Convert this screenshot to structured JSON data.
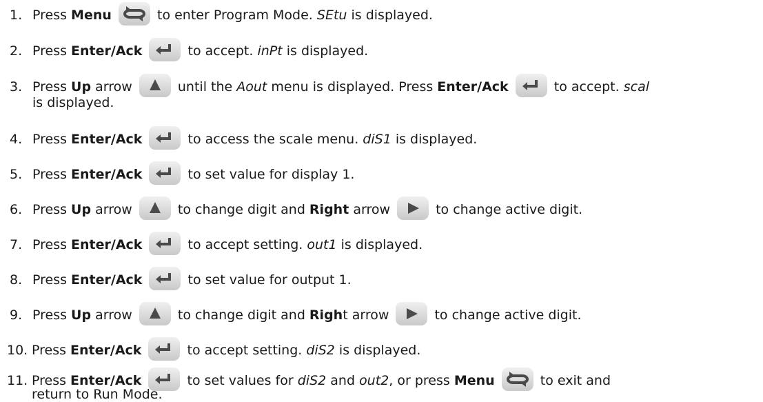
{
  "steps": [
    {
      "num": "1.",
      "parts": [
        "Press ",
        "Menu",
        "to enter Program Mode. ",
        "SEtu",
        " is displayed."
      ]
    },
    {
      "num": "2.",
      "parts": [
        "Press ",
        "Enter/Ack",
        "to accept. ",
        "inPt",
        " is displayed."
      ]
    },
    {
      "num": "3.",
      "parts": [
        "Press ",
        "Up",
        " arrow",
        "until the ",
        "Aout",
        " menu is displayed. Press ",
        "Enter/Ack",
        "to accept. ",
        "scal",
        "is displayed."
      ]
    },
    {
      "num": "4.",
      "parts": [
        "Press ",
        "Enter/Ack",
        "to access the scale menu. ",
        "diS1",
        " is displayed."
      ]
    },
    {
      "num": "5.",
      "parts": [
        "Press ",
        "Enter/Ack",
        "to set value for display 1."
      ]
    },
    {
      "num": "6.",
      "parts": [
        "Press ",
        "Up",
        " arrow",
        "to change digit and ",
        "Right",
        " arrow",
        "to change active digit."
      ]
    },
    {
      "num": "7.",
      "parts": [
        "Press ",
        "Enter/Ack",
        "to accept setting. ",
        "out1",
        " is displayed."
      ]
    },
    {
      "num": "8.",
      "parts": [
        "Press ",
        "Enter/Ack",
        "to set value for output 1."
      ]
    },
    {
      "num": "9.",
      "parts": [
        "Press ",
        "Up",
        " arrow",
        "to change digit and ",
        "Righ",
        "t arrow",
        "to change active digit."
      ]
    },
    {
      "num": "10.",
      "parts": [
        "Press ",
        "Enter/Ack",
        "to accept setting. ",
        "diS2",
        " is displayed."
      ]
    },
    {
      "num": "11.",
      "parts": [
        "Press ",
        "Enter/Ack",
        "to set values for ",
        "diS2",
        " and ",
        "out2",
        ", or press ",
        "Menu",
        "to exit and",
        "return to Run Mode."
      ]
    }
  ],
  "icons": {
    "menu": "menu-loop-icon",
    "enter": "enter-ack-icon",
    "up": "up-arrow-icon",
    "right": "right-arrow-icon"
  },
  "colors": {
    "key_glyph": "#4a4a4a",
    "key_face": "#d8d8d8",
    "text": "#1a1a1a"
  }
}
